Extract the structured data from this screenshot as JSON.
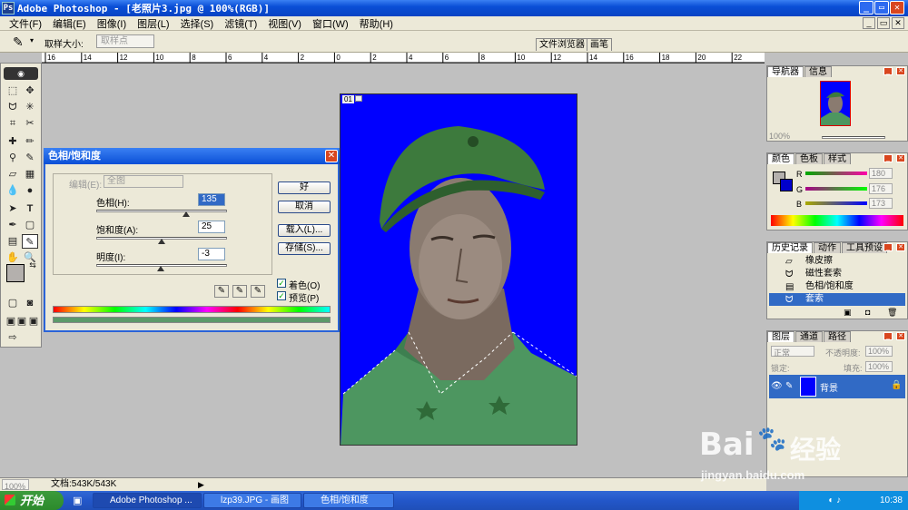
{
  "app": {
    "title": "Adobe Photoshop - [老照片3.jpg @ 100%(RGB)]",
    "window_minimize": "_",
    "window_restore": "▭",
    "window_close": "✕"
  },
  "menu": [
    "文件(F)",
    "编辑(E)",
    "图像(I)",
    "图层(L)",
    "选择(S)",
    "滤镜(T)",
    "视图(V)",
    "窗口(W)",
    "帮助(H)"
  ],
  "options_bar": {
    "sample_size_label": "取样大小:",
    "sample_size_value": "取样点",
    "well_tabs": [
      "文件浏览器",
      "画笔"
    ]
  },
  "ruler_ticks": [
    "16",
    "14",
    "12",
    "10",
    "8",
    "6",
    "4",
    "2",
    "0",
    "2",
    "4",
    "6",
    "8",
    "10",
    "12",
    "14",
    "16",
    "18",
    "20",
    "22"
  ],
  "document": {
    "badge": "01"
  },
  "dialog": {
    "title": "色相/饱和度",
    "edit_label": "编辑(E):",
    "edit_value": "全图",
    "hue_label": "色相(H):",
    "hue_value": "135",
    "saturation_label": "饱和度(A):",
    "saturation_value": "25",
    "lightness_label": "明度(I):",
    "lightness_value": "-3",
    "hue_level": 0.69,
    "saturation_level": 0.5,
    "lightness_level": 0.49,
    "ok_label": "好",
    "cancel_label": "取消",
    "load_label": "载入(L)...",
    "save_label": "存储(S)...",
    "colorize_label": "着色(O)",
    "colorize_checked": true,
    "preview_label": "预览(P)",
    "preview_checked": true
  },
  "navigator_panel": {
    "tabs": [
      "导航器",
      "信息"
    ],
    "zoom_value": "100%"
  },
  "color_panel": {
    "tabs": [
      "颜色",
      "色板",
      "样式"
    ],
    "channels": [
      {
        "name": "R",
        "value": "180"
      },
      {
        "name": "G",
        "value": "176"
      },
      {
        "name": "B",
        "value": "173"
      }
    ]
  },
  "history_panel": {
    "tabs": [
      "历史记录",
      "动作",
      "工具预设"
    ],
    "items": [
      "橡皮擦",
      "磁性套索",
      "色相/饱和度",
      "套索"
    ],
    "selected_index": 3
  },
  "layers_panel": {
    "tabs": [
      "图层",
      "通道",
      "路径"
    ],
    "blend_mode": "正常",
    "opacity_label": "不透明度:",
    "opacity_value": "100%",
    "lock_label": "锁定:",
    "fill_label": "填充:",
    "fill_value": "100%",
    "layer_name": "背景"
  },
  "status_bar": {
    "zoom": "100%",
    "doc_info": "文档:543K/543K"
  },
  "taskbar": {
    "start_label": "开始",
    "items": [
      "Adobe Photoshop ...",
      "lzp39.JPG - 画图",
      "色相/饱和度"
    ],
    "clock": "10:38"
  },
  "watermark": {
    "brand_text": "Bai",
    "brand_text2": "经验",
    "url": "jingyan.baidu.com"
  },
  "colors": {
    "title_blue": "#0a4fd6",
    "canvas_blue": "#0000ff",
    "history_selected": "#316ac5",
    "foreground": "#b4b0ad",
    "background": "#0000cc"
  }
}
